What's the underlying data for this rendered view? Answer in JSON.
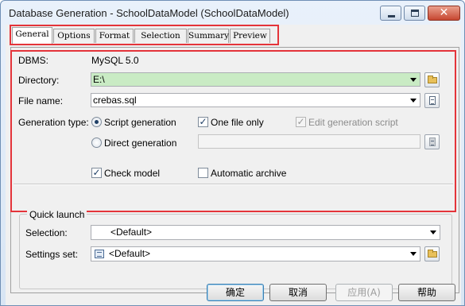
{
  "window": {
    "title": "Database Generation - SchoolDataModel (SchoolDataModel)"
  },
  "window_controls": {
    "close": "✕"
  },
  "tabs": [
    {
      "label": "General",
      "active": true
    },
    {
      "label": "Options",
      "active": false
    },
    {
      "label": "Format",
      "active": false
    },
    {
      "label": "Selection",
      "active": false
    },
    {
      "label": "Summary",
      "active": false
    },
    {
      "label": "Preview",
      "active": false
    }
  ],
  "general": {
    "dbms_label": "DBMS:",
    "dbms_value": "MySQL 5.0",
    "directory_label": "Directory:",
    "directory_value": "E:\\",
    "filename_label": "File name:",
    "filename_value": "crebas.sql",
    "gentype_label": "Generation type:",
    "script_generation": "Script generation",
    "direct_generation": "Direct generation",
    "one_file_only": "One file only",
    "edit_generation_script": "Edit generation script",
    "direct_value": "",
    "check_model": "Check model",
    "automatic_archive": "Automatic archive",
    "check_mark": "✓"
  },
  "quick_launch": {
    "title": "Quick launch",
    "selection_label": "Selection:",
    "selection_value": "<Default>",
    "settings_label": "Settings set:",
    "settings_value": "<Default>"
  },
  "buttons": {
    "ok": "确定",
    "cancel": "取消",
    "apply": "应用(A)",
    "help": "帮助"
  },
  "colors": {
    "highlight": "#e4343a",
    "directory_bg": "#c9ebc4",
    "accent": "#1f3f66"
  }
}
